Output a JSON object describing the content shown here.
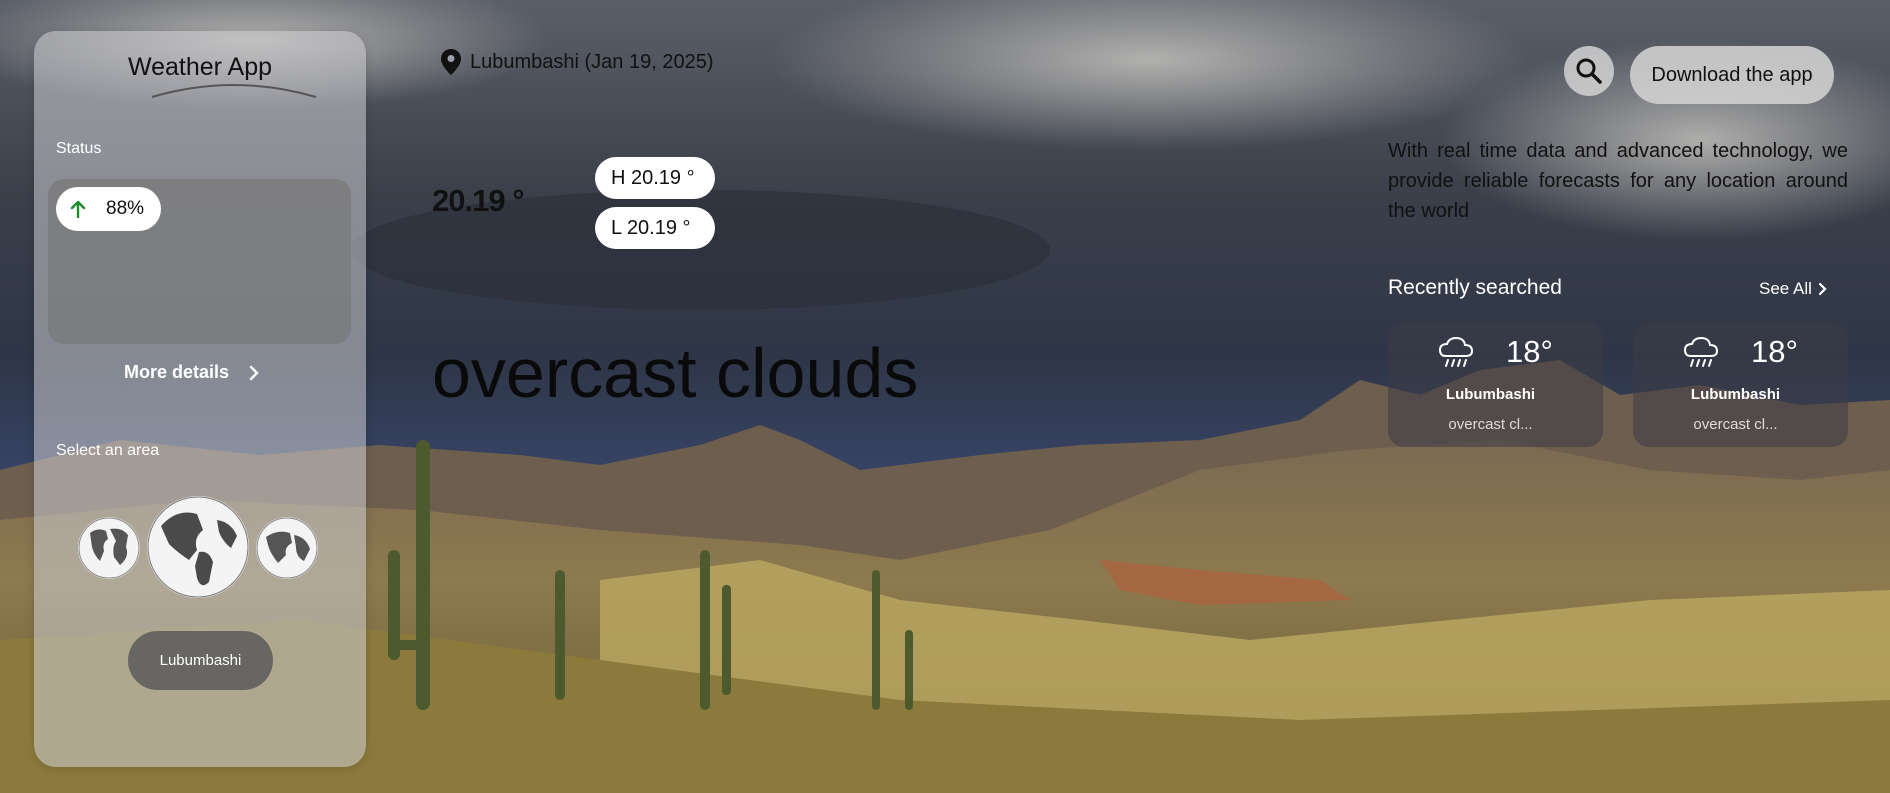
{
  "app": {
    "title": "Weather App"
  },
  "sidebar": {
    "status_label": "Status",
    "status_value": "88%",
    "more_details_label": "More details",
    "select_area_label": "Select an area",
    "area_button_label": "Lubumbashi"
  },
  "main": {
    "location": "Lubumbashi (Jan 19, 2025)",
    "temperature": "20.19 °",
    "high": "H 20.19 °",
    "low": "L 20.19 °",
    "condition": "overcast clouds"
  },
  "header": {
    "download_label": "Download the app"
  },
  "tagline": "With real time data and advanced technology, we provide reliable forecasts for any location around the world",
  "recent": {
    "title": "Recently searched",
    "see_all_label": "See All",
    "cards": [
      {
        "temp": "18°",
        "city": "Lubumbashi",
        "desc": "overcast cl...",
        "icon": "rain-cloud-icon"
      },
      {
        "temp": "18°",
        "city": "Lubumbashi",
        "desc": "overcast cl...",
        "icon": "rain-cloud-icon"
      }
    ]
  },
  "colors": {
    "status_arrow": "#1e8a2e",
    "card_bg": "#3c3c46",
    "sky_dark": "#3a4250"
  }
}
